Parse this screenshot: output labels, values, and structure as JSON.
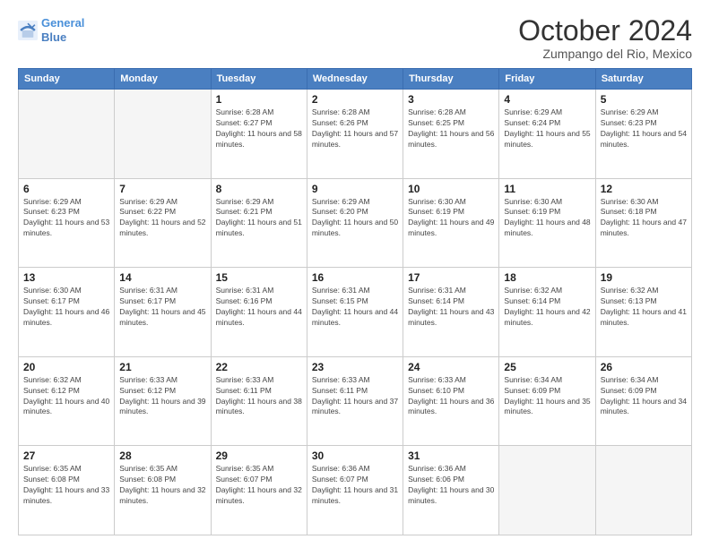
{
  "logo": {
    "line1": "General",
    "line2": "Blue"
  },
  "title": "October 2024",
  "location": "Zumpango del Rio, Mexico",
  "days_header": [
    "Sunday",
    "Monday",
    "Tuesday",
    "Wednesday",
    "Thursday",
    "Friday",
    "Saturday"
  ],
  "weeks": [
    [
      {
        "day": "",
        "info": ""
      },
      {
        "day": "",
        "info": ""
      },
      {
        "day": "1",
        "info": "Sunrise: 6:28 AM\nSunset: 6:27 PM\nDaylight: 11 hours and 58 minutes."
      },
      {
        "day": "2",
        "info": "Sunrise: 6:28 AM\nSunset: 6:26 PM\nDaylight: 11 hours and 57 minutes."
      },
      {
        "day": "3",
        "info": "Sunrise: 6:28 AM\nSunset: 6:25 PM\nDaylight: 11 hours and 56 minutes."
      },
      {
        "day": "4",
        "info": "Sunrise: 6:29 AM\nSunset: 6:24 PM\nDaylight: 11 hours and 55 minutes."
      },
      {
        "day": "5",
        "info": "Sunrise: 6:29 AM\nSunset: 6:23 PM\nDaylight: 11 hours and 54 minutes."
      }
    ],
    [
      {
        "day": "6",
        "info": "Sunrise: 6:29 AM\nSunset: 6:23 PM\nDaylight: 11 hours and 53 minutes."
      },
      {
        "day": "7",
        "info": "Sunrise: 6:29 AM\nSunset: 6:22 PM\nDaylight: 11 hours and 52 minutes."
      },
      {
        "day": "8",
        "info": "Sunrise: 6:29 AM\nSunset: 6:21 PM\nDaylight: 11 hours and 51 minutes."
      },
      {
        "day": "9",
        "info": "Sunrise: 6:29 AM\nSunset: 6:20 PM\nDaylight: 11 hours and 50 minutes."
      },
      {
        "day": "10",
        "info": "Sunrise: 6:30 AM\nSunset: 6:19 PM\nDaylight: 11 hours and 49 minutes."
      },
      {
        "day": "11",
        "info": "Sunrise: 6:30 AM\nSunset: 6:19 PM\nDaylight: 11 hours and 48 minutes."
      },
      {
        "day": "12",
        "info": "Sunrise: 6:30 AM\nSunset: 6:18 PM\nDaylight: 11 hours and 47 minutes."
      }
    ],
    [
      {
        "day": "13",
        "info": "Sunrise: 6:30 AM\nSunset: 6:17 PM\nDaylight: 11 hours and 46 minutes."
      },
      {
        "day": "14",
        "info": "Sunrise: 6:31 AM\nSunset: 6:17 PM\nDaylight: 11 hours and 45 minutes."
      },
      {
        "day": "15",
        "info": "Sunrise: 6:31 AM\nSunset: 6:16 PM\nDaylight: 11 hours and 44 minutes."
      },
      {
        "day": "16",
        "info": "Sunrise: 6:31 AM\nSunset: 6:15 PM\nDaylight: 11 hours and 44 minutes."
      },
      {
        "day": "17",
        "info": "Sunrise: 6:31 AM\nSunset: 6:14 PM\nDaylight: 11 hours and 43 minutes."
      },
      {
        "day": "18",
        "info": "Sunrise: 6:32 AM\nSunset: 6:14 PM\nDaylight: 11 hours and 42 minutes."
      },
      {
        "day": "19",
        "info": "Sunrise: 6:32 AM\nSunset: 6:13 PM\nDaylight: 11 hours and 41 minutes."
      }
    ],
    [
      {
        "day": "20",
        "info": "Sunrise: 6:32 AM\nSunset: 6:12 PM\nDaylight: 11 hours and 40 minutes."
      },
      {
        "day": "21",
        "info": "Sunrise: 6:33 AM\nSunset: 6:12 PM\nDaylight: 11 hours and 39 minutes."
      },
      {
        "day": "22",
        "info": "Sunrise: 6:33 AM\nSunset: 6:11 PM\nDaylight: 11 hours and 38 minutes."
      },
      {
        "day": "23",
        "info": "Sunrise: 6:33 AM\nSunset: 6:11 PM\nDaylight: 11 hours and 37 minutes."
      },
      {
        "day": "24",
        "info": "Sunrise: 6:33 AM\nSunset: 6:10 PM\nDaylight: 11 hours and 36 minutes."
      },
      {
        "day": "25",
        "info": "Sunrise: 6:34 AM\nSunset: 6:09 PM\nDaylight: 11 hours and 35 minutes."
      },
      {
        "day": "26",
        "info": "Sunrise: 6:34 AM\nSunset: 6:09 PM\nDaylight: 11 hours and 34 minutes."
      }
    ],
    [
      {
        "day": "27",
        "info": "Sunrise: 6:35 AM\nSunset: 6:08 PM\nDaylight: 11 hours and 33 minutes."
      },
      {
        "day": "28",
        "info": "Sunrise: 6:35 AM\nSunset: 6:08 PM\nDaylight: 11 hours and 32 minutes."
      },
      {
        "day": "29",
        "info": "Sunrise: 6:35 AM\nSunset: 6:07 PM\nDaylight: 11 hours and 32 minutes."
      },
      {
        "day": "30",
        "info": "Sunrise: 6:36 AM\nSunset: 6:07 PM\nDaylight: 11 hours and 31 minutes."
      },
      {
        "day": "31",
        "info": "Sunrise: 6:36 AM\nSunset: 6:06 PM\nDaylight: 11 hours and 30 minutes."
      },
      {
        "day": "",
        "info": ""
      },
      {
        "day": "",
        "info": ""
      }
    ]
  ]
}
